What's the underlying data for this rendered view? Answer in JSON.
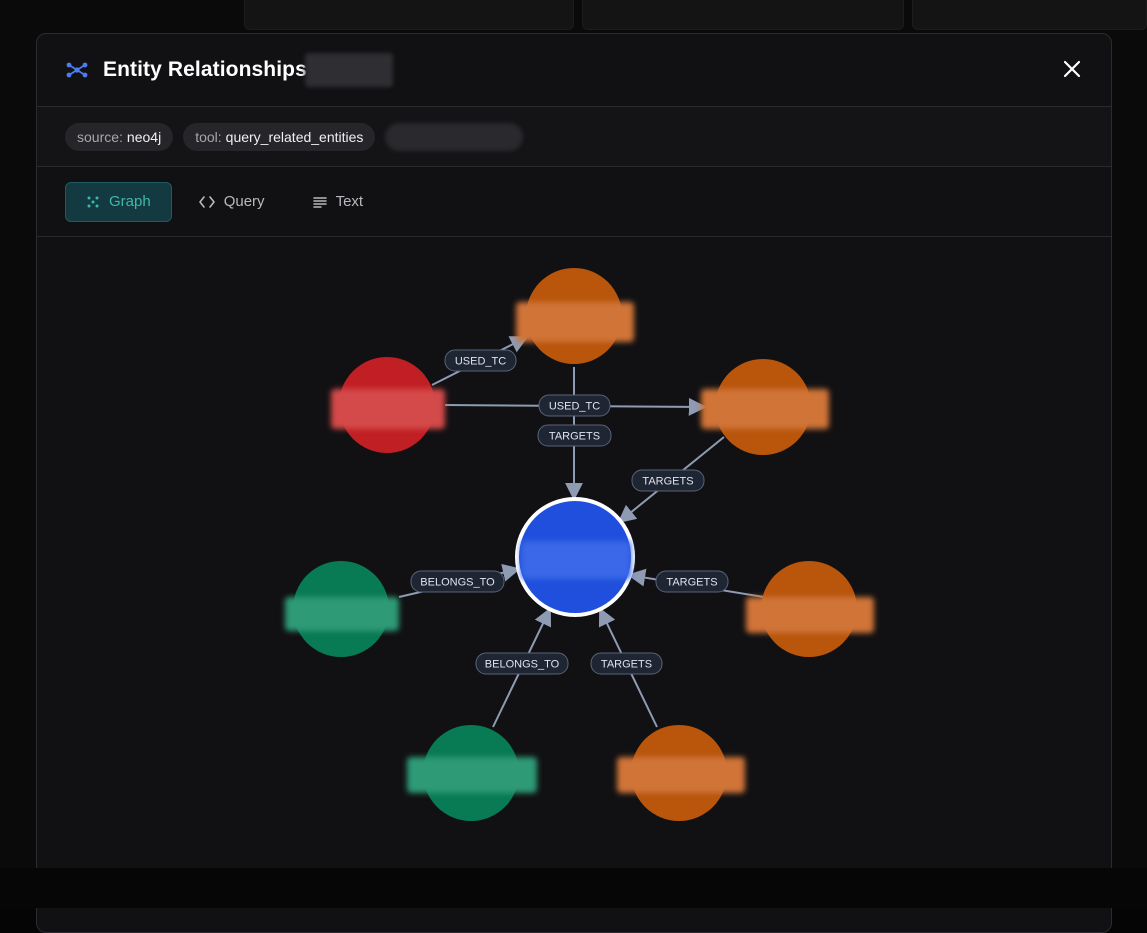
{
  "modal": {
    "title": "Entity Relationships",
    "close_icon": "close-icon",
    "title_icon": "graph-network-icon"
  },
  "meta": {
    "source_key": "source:",
    "source_value": "neo4j",
    "tool_key": "tool:",
    "tool_value": "query_related_entities"
  },
  "tabs": [
    {
      "label": "Graph",
      "icon": "graph-icon",
      "active": true
    },
    {
      "label": "Query",
      "icon": "code-icon",
      "active": false
    },
    {
      "label": "Text",
      "icon": "text-lines-icon",
      "active": false
    }
  ],
  "graph": {
    "colors": {
      "center": "#1f4fdc",
      "orange": "#b9560c",
      "red": "#c01f24",
      "green": "#087a54",
      "edge": "#8e9bb3"
    },
    "edge_labels": {
      "red_to_top": "USED_TC",
      "red_to_right": "USED_TC",
      "top_to_center": "TARGETS",
      "right_to_center": "TARGETS",
      "right2_to_center": "TARGETS",
      "green_left_to_center": "BELONGS_TO",
      "green_bottom_to_center": "BELONGS_TO",
      "orange_bottom_to_center": "TARGETS"
    }
  }
}
